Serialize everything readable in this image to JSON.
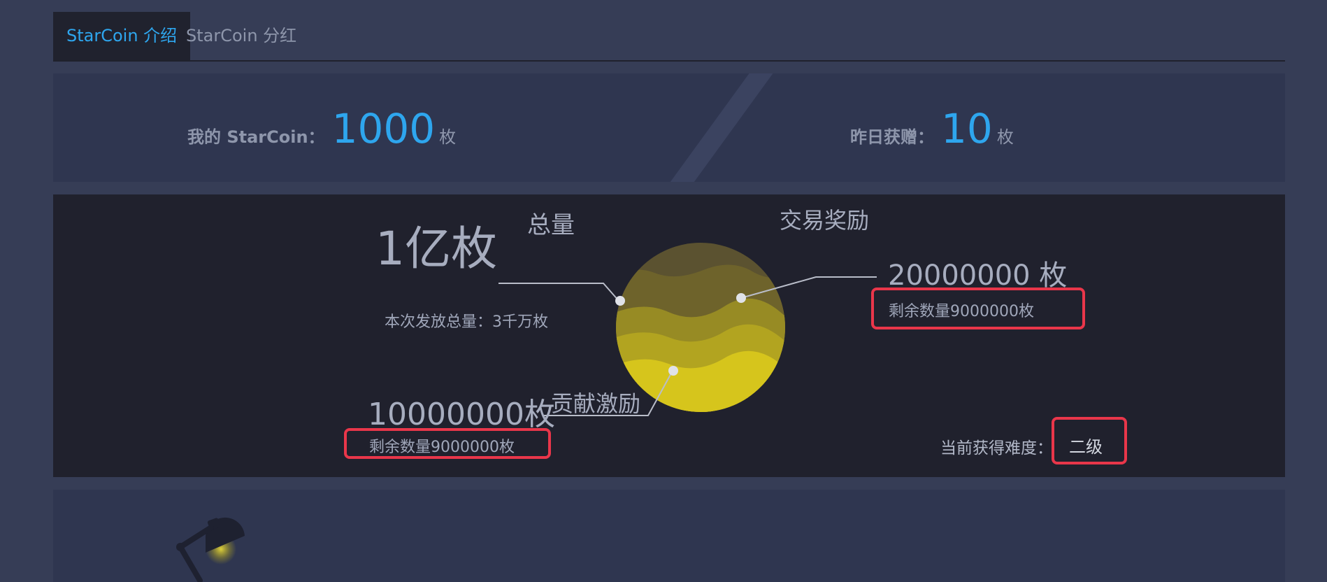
{
  "tabs": [
    {
      "label": "StarCoin 介绍"
    },
    {
      "label": "StarCoin 分红"
    }
  ],
  "stats": {
    "my_label": "我的 StarCoin：",
    "my_value": "1000",
    "my_unit": "枚",
    "yesterday_label": "昨日获赠：",
    "yesterday_value": "10",
    "yesterday_unit": "枚"
  },
  "distribution": {
    "total": {
      "value": "1亿枚",
      "caption": "总量",
      "issue_note": "本次发放总量：3千万枚"
    },
    "trade_reward": {
      "caption": "交易奖励",
      "value": "20000000 枚",
      "remaining": "剩余数量9000000枚"
    },
    "contribution_reward": {
      "caption": "贡献激励",
      "value": "10000000枚",
      "remaining": "剩余数量9000000枚"
    },
    "difficulty": {
      "label": "当前获得难度：",
      "value": "二级"
    }
  },
  "colors": {
    "accent": "#2ea6ee",
    "highlight_box": "#e9364a",
    "planet": "#d6c51c"
  },
  "icons": {
    "planet": "planet-illustration",
    "lamp": "desk-lamp-icon"
  }
}
